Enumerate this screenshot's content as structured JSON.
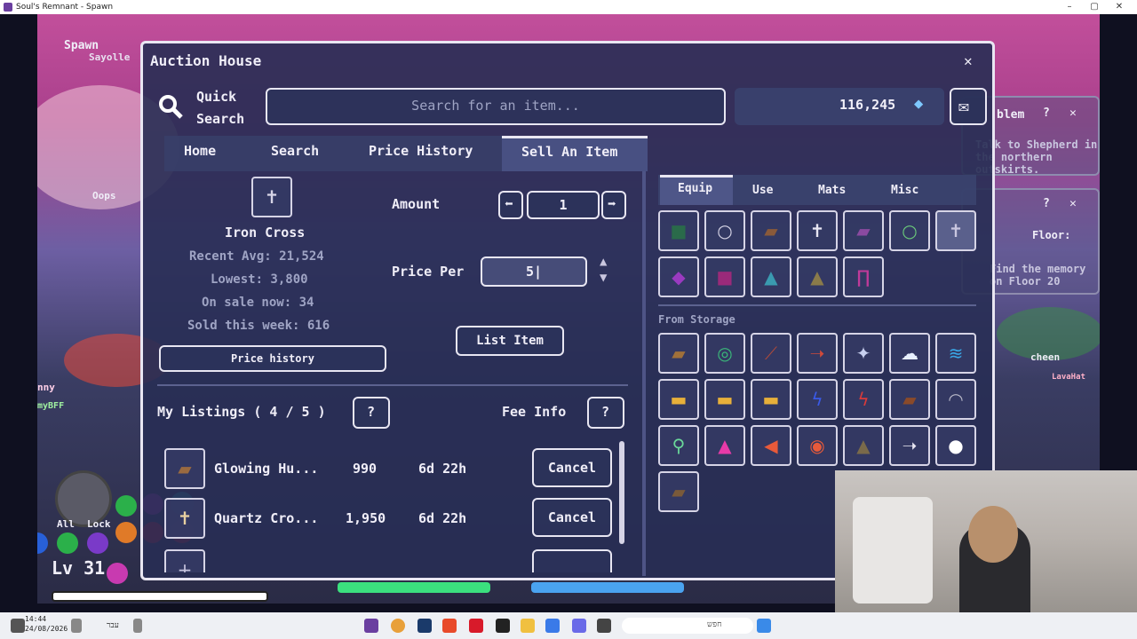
{
  "window": {
    "title": "Soul's Remnant - Spawn",
    "min": "–",
    "max": "▢",
    "close": "✕"
  },
  "scene": {
    "location": "Spawn",
    "players": [
      "Sayolle",
      "Oops",
      "nny",
      "myBFF",
      "cheen",
      "LavaHat"
    ],
    "quest1_title": "blem",
    "quest1_text": "Talk to Shepherd in the northern outskirts.",
    "quest2_title": "Floor:",
    "quest2_text": "Find the memory on Floor 20",
    "level": "Lv 31",
    "hud_all": "All",
    "hud_lock": "Lock"
  },
  "auction": {
    "title": "Auction House",
    "close": "✕",
    "quick_search": "Quick Search",
    "search_placeholder": "Search for an item...",
    "currency": "116,245",
    "tabs": [
      "Home",
      "Search",
      "Price History",
      "Sell An Item"
    ],
    "active_tab": "Sell An Item",
    "item": {
      "name": "Iron Cross",
      "recent_avg": "Recent Avg: 21,524",
      "lowest": "Lowest: 3,800",
      "on_sale": "On sale now: 34",
      "sold_week": "Sold this week: 616"
    },
    "price_history_btn": "Price history",
    "amount_label": "Amount",
    "amount_value": "1",
    "price_label": "Price Per",
    "price_value": "5|",
    "list_btn": "List Item",
    "my_listings": "My Listings ( 4 / 5 )",
    "help": "?",
    "fee_info": "Fee Info",
    "listings": [
      {
        "name": "Glowing Hu...",
        "price": "990",
        "time": "6d 22h",
        "action": "Cancel"
      },
      {
        "name": "Quartz Cro...",
        "price": "1,950",
        "time": "6d 22h",
        "action": "Cancel"
      }
    ],
    "inv_tabs": [
      "Equip",
      "Use",
      "Mats",
      "Misc"
    ],
    "active_inv_tab": "Equip",
    "from_storage": "From Storage"
  },
  "colors": {
    "accent": "#e8e6f2",
    "panel": "#2c325a",
    "hp": "#3be07e",
    "mp": "#4aa3f0"
  },
  "taskbar": {
    "time": "14:44",
    "date": "24/08/2026",
    "lang": "עבר",
    "search": "חפש"
  }
}
